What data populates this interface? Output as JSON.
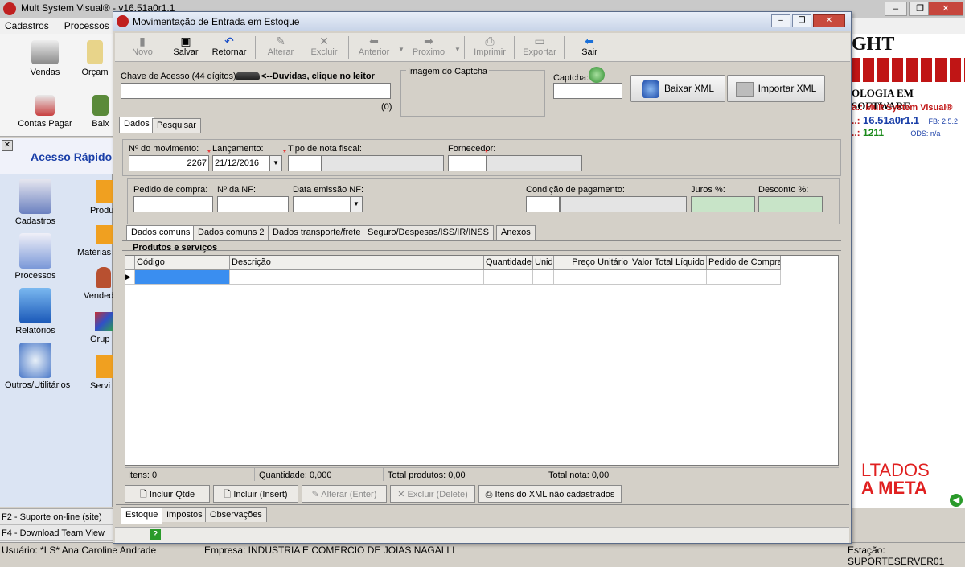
{
  "app": {
    "title": "Mult System Visual® - v16.51a0r1.1",
    "menu": [
      "Cadastros",
      "Processos"
    ],
    "toolbar": [
      {
        "label": "Vendas",
        "icon": "cash-register-icon"
      },
      {
        "label": "Orçam",
        "icon": "pencil-icon"
      },
      {
        "label": "Contas Pagar",
        "icon": "money-icon"
      },
      {
        "label": "Baix",
        "icon": "books-icon"
      }
    ],
    "window_controls": {
      "minimize": "–",
      "restore": "❐",
      "close": "✕"
    }
  },
  "acesso": {
    "title": "Acesso Rápido",
    "close": "✕",
    "items": [
      {
        "label": "Cadastros",
        "icon": "user-clipboard-icon"
      },
      {
        "label": "Processos",
        "icon": "pen-document-icon"
      },
      {
        "label": "Relatórios",
        "icon": "cabinet-icon"
      },
      {
        "label": "Outros/Utilitários",
        "icon": "cd-icon"
      }
    ],
    "items2": [
      {
        "label": "Produ",
        "icon": "product-icon"
      },
      {
        "label": "Matérias",
        "icon": "materials-icon"
      },
      {
        "label": "Vended",
        "icon": "seller-icon"
      },
      {
        "label": "Grup",
        "icon": "cubes-icon"
      },
      {
        "label": "Servi",
        "icon": "service-icon"
      }
    ]
  },
  "help_footer": [
    "F2 - Suporte on-line (site)",
    "F4 - Download Team View"
  ],
  "status_bar": {
    "user": "Usuário: *LS* Ana Caroline Andrade",
    "company": "Empresa: INDUSTRIA E COMERCIO DE JOIAS NAGALLI",
    "station": "Estação: SUPORTESERVER01"
  },
  "banner": {
    "brand": "GHT SYSTEM",
    "tagline": "OLOGIA EM SOFTWARE",
    "rows": [
      {
        "label": "a.:",
        "value": "Mult System Visual®"
      },
      {
        "label": "..:",
        "value": "16.51a0r1.1",
        "extra": "FB: 2.5.2"
      },
      {
        "label": "..:",
        "value": "1211",
        "extra": "ODS: n/a"
      }
    ],
    "slogan1": "LTADOS",
    "slogan2": "A META"
  },
  "dialog": {
    "title": "Movimentação de Entrada em Estoque",
    "toolbar": [
      {
        "label": "Novo",
        "icon": "new-doc-icon",
        "enabled": false
      },
      {
        "label": "Salvar",
        "icon": "save-icon",
        "enabled": true
      },
      {
        "label": "Retornar",
        "icon": "undo-icon",
        "enabled": true
      },
      {
        "label": "Alterar",
        "icon": "edit-icon",
        "enabled": false
      },
      {
        "label": "Excluir",
        "icon": "delete-icon",
        "enabled": false
      },
      {
        "label": "Anterior",
        "icon": "arrow-left-icon",
        "enabled": false
      },
      {
        "label": "Proximo",
        "icon": "arrow-right-icon",
        "enabled": false
      },
      {
        "label": "Imprimir",
        "icon": "printer-icon",
        "enabled": false
      },
      {
        "label": "Exportar",
        "icon": "folder-icon",
        "enabled": false
      },
      {
        "label": "Sair",
        "icon": "exit-arrow-icon",
        "enabled": true
      }
    ],
    "chave": {
      "label": "Chave de Acesso (44 dígitos):",
      "help": "<--Duvidas, clique no leitor",
      "value": "",
      "count": "(0)"
    },
    "captcha_image_label": "Imagem do Captcha",
    "captcha_label": "Captcha:",
    "captcha_value": "",
    "baixar_xml": "Baixar XML",
    "importar_xml": "Importar XML",
    "tabs": [
      "Dados",
      "Pesquisar"
    ],
    "fields": {
      "num_mov_label": "Nº do movimento:",
      "num_mov": "2267",
      "lancamento_label": "Lançamento:",
      "lancamento": "21/12/2016",
      "tipo_nf_label": "Tipo de nota fiscal:",
      "fornecedor_label": "Fornecedor:",
      "pedido_label": "Pedido de compra:",
      "nf_label": "Nº da NF:",
      "data_emissao_label": "Data emissão NF:",
      "condicao_label": "Condição de pagamento:",
      "juros_label": "Juros %:",
      "desconto_label": "Desconto %:",
      "required": "*"
    },
    "sub_tabs": [
      "Dados comuns",
      "Dados comuns 2",
      "Dados transporte/frete",
      "Seguro/Despesas/ISS/IR/INSS",
      "Anexos"
    ],
    "products_title": "Produtos e serviços",
    "grid_columns": [
      "Código",
      "Descrição",
      "Quantidade",
      "Unid",
      "Preço Unitário",
      "Valor Total Líquido",
      "Pedido de Compra"
    ],
    "row_marker": "▶",
    "totals": {
      "itens": "Itens: 0",
      "quantidade": "Quantidade: 0,000",
      "total_produtos": "Total produtos: 0,00",
      "total_nota": "Total nota: 0,00"
    },
    "grid_buttons": [
      {
        "label": "Incluir Qtde",
        "enabled": true
      },
      {
        "label": "Incluir (Insert)",
        "enabled": true
      },
      {
        "label": "Alterar (Enter)",
        "enabled": false
      },
      {
        "label": "Excluir (Delete)",
        "enabled": false
      },
      {
        "label": "Itens do XML não cadastrados",
        "enabled": true
      }
    ],
    "bottom_tabs": [
      "Estoque",
      "Impostos",
      "Observações"
    ],
    "help_icon": "?"
  }
}
